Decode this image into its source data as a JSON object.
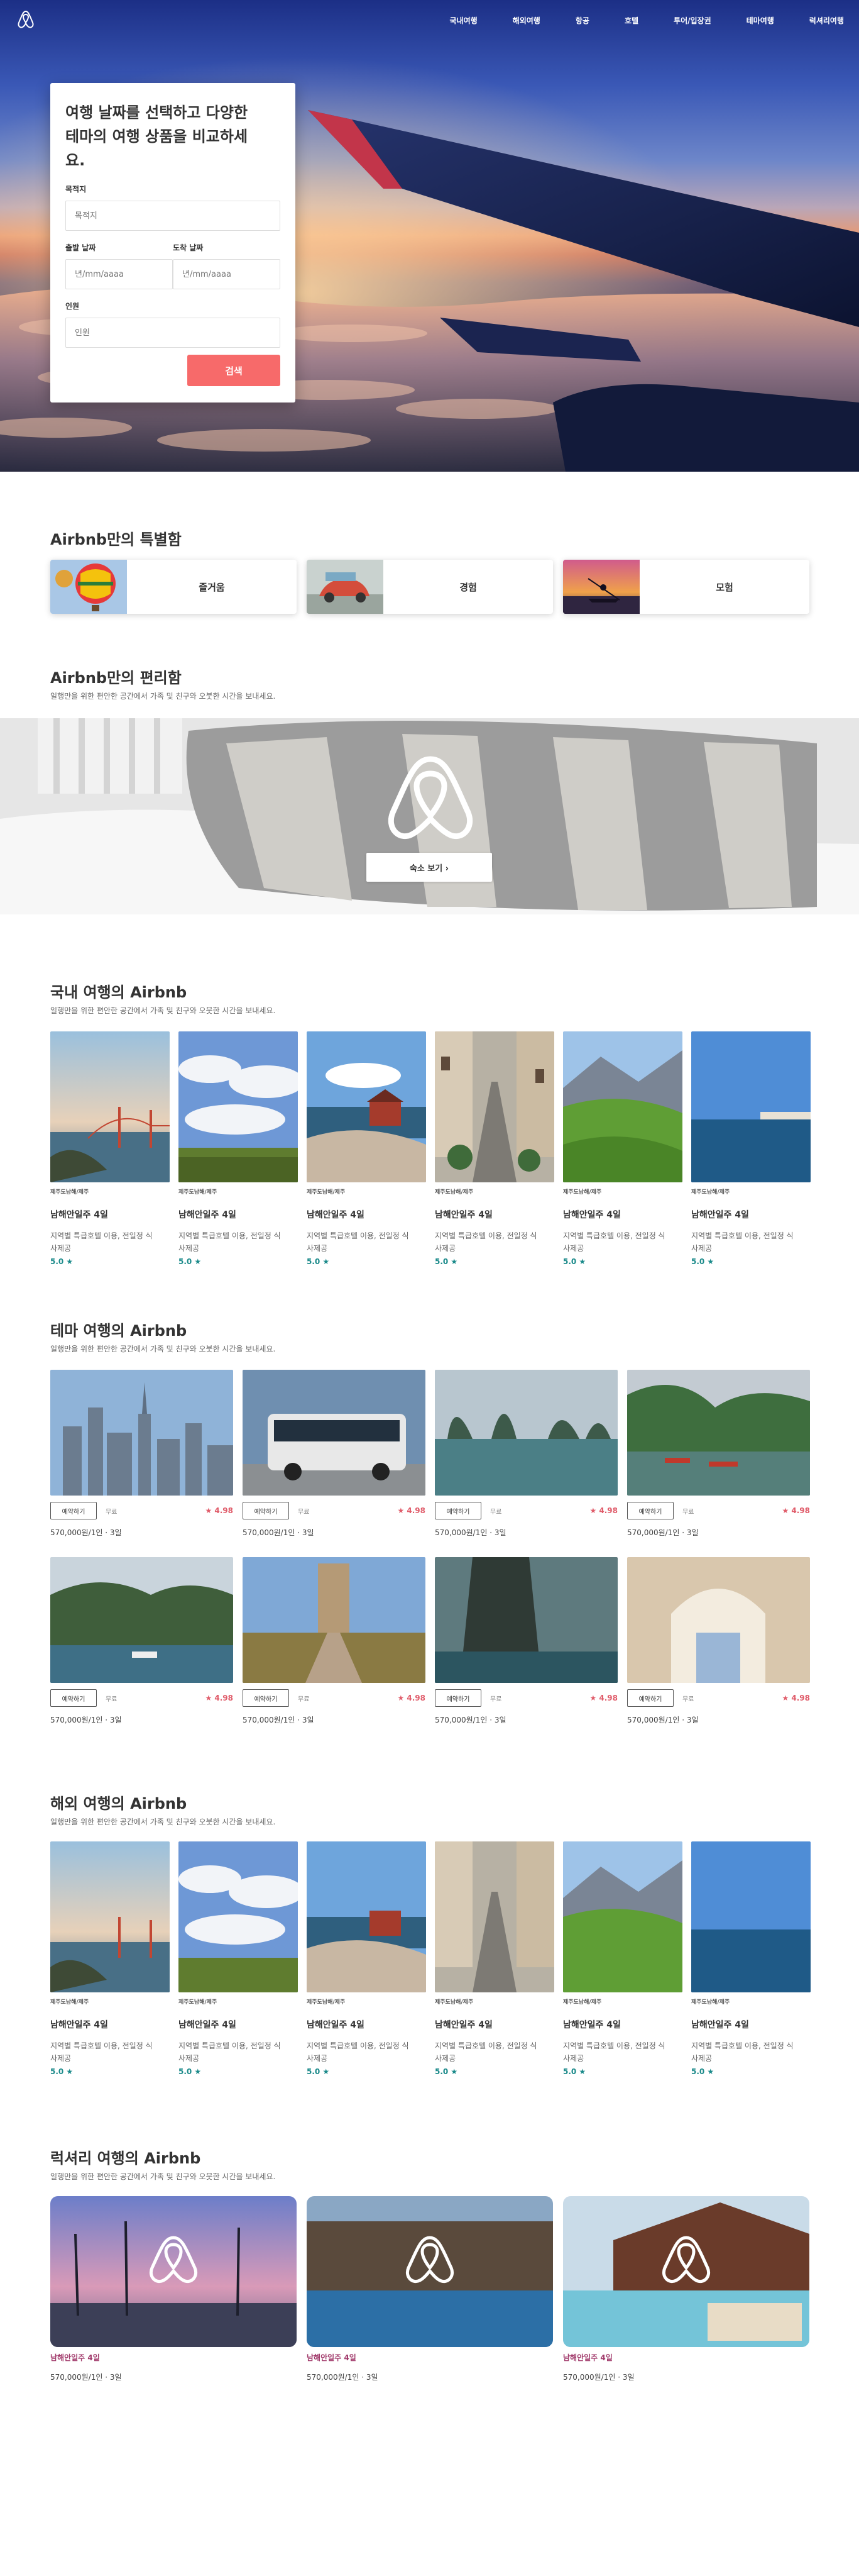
{
  "nav": {
    "items": [
      "국내여행",
      "해외여행",
      "항공",
      "호텔",
      "투어/입장권",
      "테마여행",
      "럭셔리여행"
    ]
  },
  "search": {
    "title": "여행 날짜를 선택하고 다양한 테마의 여행 상품을 비교하세요.",
    "destination_label": "목적지",
    "destination_placeholder": "목적지",
    "depart_label": "출발 날짜",
    "depart_placeholder": "년/mm/aaaa",
    "arrive_label": "도착 날짜",
    "arrive_placeholder": "년/mm/aaaa",
    "guests_label": "인원",
    "guests_placeholder": "인원",
    "button": "검색"
  },
  "special": {
    "title": "Airbnb만의 특별함",
    "cards": [
      {
        "label": "즐거움"
      },
      {
        "label": "경험"
      },
      {
        "label": "모험"
      }
    ]
  },
  "convenience": {
    "title": "Airbnb만의 편리함",
    "subtitle": "일행만을 위한 편안한 공간에서 가족 및 친구와 오붓한 시간을 보내세요.",
    "button": "숙소 보기"
  },
  "domestic": {
    "title": "국내 여행의 Airbnb",
    "subtitle": "일행만을 위한 편안한 공간에서 가족 및 친구와 오붓한 시간을 보내세요.",
    "items": [
      {
        "tag": "제주도남해/제주",
        "title": "남해안일주 4일",
        "desc": "지역별 특급호텔 이용, 전일정 식사제공",
        "rating": "5.0 ★"
      },
      {
        "tag": "제주도남해/제주",
        "title": "남해안일주 4일",
        "desc": "지역별 특급호텔 이용, 전일정 식사제공",
        "rating": "5.0 ★"
      },
      {
        "tag": "제주도남해/제주",
        "title": "남해안일주 4일",
        "desc": "지역별 특급호텔 이용, 전일정 식사제공",
        "rating": "5.0 ★"
      },
      {
        "tag": "제주도남해/제주",
        "title": "남해안일주 4일",
        "desc": "지역별 특급호텔 이용, 전일정 식사제공",
        "rating": "5.0 ★"
      },
      {
        "tag": "제주도남해/제주",
        "title": "남해안일주 4일",
        "desc": "지역별 특급호텔 이용, 전일정 식사제공",
        "rating": "5.0 ★"
      },
      {
        "tag": "제주도남해/제주",
        "title": "남해안일주 4일",
        "desc": "지역별 특급호텔 이용, 전일정 식사제공",
        "rating": "5.0 ★"
      }
    ]
  },
  "theme": {
    "title": "테마 여행의 Airbnb",
    "subtitle": "일행만을 위한 편안한 공간에서 가족 및 친구와 오붓한 시간을 보내세요.",
    "items": [
      {
        "button": "예약하기",
        "free": "무료",
        "rating": "★ 4.98",
        "price": "570,000원/1인 · 3일"
      },
      {
        "button": "예약하기",
        "free": "무료",
        "rating": "★ 4.98",
        "price": "570,000원/1인 · 3일"
      },
      {
        "button": "예약하기",
        "free": "무료",
        "rating": "★ 4.98",
        "price": "570,000원/1인 · 3일"
      },
      {
        "button": "예약하기",
        "free": "무료",
        "rating": "★ 4.98",
        "price": "570,000원/1인 · 3일"
      },
      {
        "button": "예약하기",
        "free": "무료",
        "rating": "★ 4.98",
        "price": "570,000원/1인 · 3일"
      },
      {
        "button": "예약하기",
        "free": "무료",
        "rating": "★ 4.98",
        "price": "570,000원/1인 · 3일"
      },
      {
        "button": "예약하기",
        "free": "무료",
        "rating": "★ 4.98",
        "price": "570,000원/1인 · 3일"
      },
      {
        "button": "예약하기",
        "free": "무료",
        "rating": "★ 4.98",
        "price": "570,000원/1인 · 3일"
      }
    ]
  },
  "overseas": {
    "title": "해외 여행의 Airbnb",
    "subtitle": "일행만을 위한 편안한 공간에서 가족 및 친구와 오붓한 시간을 보내세요.",
    "items": [
      {
        "tag": "제주도남해/제주",
        "title": "남해안일주 4일",
        "desc": "지역별 특급호텔 이용, 전일정 식사제공",
        "rating": "5.0 ★"
      },
      {
        "tag": "제주도남해/제주",
        "title": "남해안일주 4일",
        "desc": "지역별 특급호텔 이용, 전일정 식사제공",
        "rating": "5.0 ★"
      },
      {
        "tag": "제주도남해/제주",
        "title": "남해안일주 4일",
        "desc": "지역별 특급호텔 이용, 전일정 식사제공",
        "rating": "5.0 ★"
      },
      {
        "tag": "제주도남해/제주",
        "title": "남해안일주 4일",
        "desc": "지역별 특급호텔 이용, 전일정 식사제공",
        "rating": "5.0 ★"
      },
      {
        "tag": "제주도남해/제주",
        "title": "남해안일주 4일",
        "desc": "지역별 특급호텔 이용, 전일정 식사제공",
        "rating": "5.0 ★"
      },
      {
        "tag": "제주도남해/제주",
        "title": "남해안일주 4일",
        "desc": "지역별 특급호텔 이용, 전일정 식사제공",
        "rating": "5.0 ★"
      }
    ]
  },
  "luxury": {
    "title": "럭셔리 여행의 Airbnb",
    "subtitle": "일행만을 위한 편안한 공간에서 가족 및 친구와 오붓한 시간을 보내세요.",
    "items": [
      {
        "title": "남해안일주 4일",
        "price": "570,000원/1인 · 3일"
      },
      {
        "title": "남해안일주 4일",
        "price": "570,000원/1인 · 3일"
      },
      {
        "title": "남해안일주 4일",
        "price": "570,000원/1인 · 3일"
      }
    ]
  },
  "colors": {
    "accent": "#f76a6a",
    "rating_teal": "#1a8a8a",
    "luxury_title": "#a13a6b"
  }
}
